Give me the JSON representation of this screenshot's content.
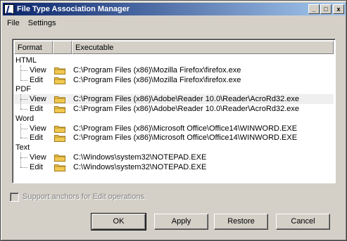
{
  "window": {
    "title": "File Type Association Manager",
    "minimize_glyph": "_",
    "maximize_glyph": "□",
    "close_glyph": "x"
  },
  "menu": {
    "items": [
      {
        "label": "File"
      },
      {
        "label": "Settings"
      }
    ]
  },
  "table": {
    "columns": [
      {
        "label": "Format"
      },
      {
        "label": ""
      },
      {
        "label": "Executable"
      }
    ],
    "groups": [
      {
        "format": "HTML",
        "actions": [
          {
            "name": "View",
            "executable": "C:\\Program Files (x86)\\Mozilla Firefox\\firefox.exe"
          },
          {
            "name": "Edit",
            "executable": "C:\\Program Files (x86)\\Mozilla Firefox\\firefox.exe"
          }
        ]
      },
      {
        "format": "PDF",
        "actions": [
          {
            "name": "View",
            "executable": "C:\\Program Files (x86)\\Adobe\\Reader 10.0\\Reader\\AcroRd32.exe"
          },
          {
            "name": "Edit",
            "executable": "C:\\Program Files (x86)\\Adobe\\Reader 10.0\\Reader\\AcroRd32.exe"
          }
        ]
      },
      {
        "format": "Word",
        "actions": [
          {
            "name": "View",
            "executable": "C:\\Program Files (x86)\\Microsoft Office\\Office14\\WINWORD.EXE"
          },
          {
            "name": "Edit",
            "executable": "C:\\Program Files (x86)\\Microsoft Office\\Office14\\WINWORD.EXE"
          }
        ]
      },
      {
        "format": "Text",
        "actions": [
          {
            "name": "View",
            "executable": "C:\\Windows\\system32\\NOTEPAD.EXE"
          },
          {
            "name": "Edit",
            "executable": "C:\\Windows\\system32\\NOTEPAD.EXE"
          }
        ]
      }
    ]
  },
  "options": {
    "support_anchors_label": "Support anchors for Edit operations.",
    "support_anchors_checked": false
  },
  "buttons": {
    "ok": "OK",
    "apply": "Apply",
    "restore": "Restore",
    "cancel": "Cancel"
  },
  "colors": {
    "titlebar_start": "#0a246a",
    "titlebar_end": "#a6caf0",
    "folder_fill": "#f0c850",
    "folder_outline": "#a07818"
  }
}
